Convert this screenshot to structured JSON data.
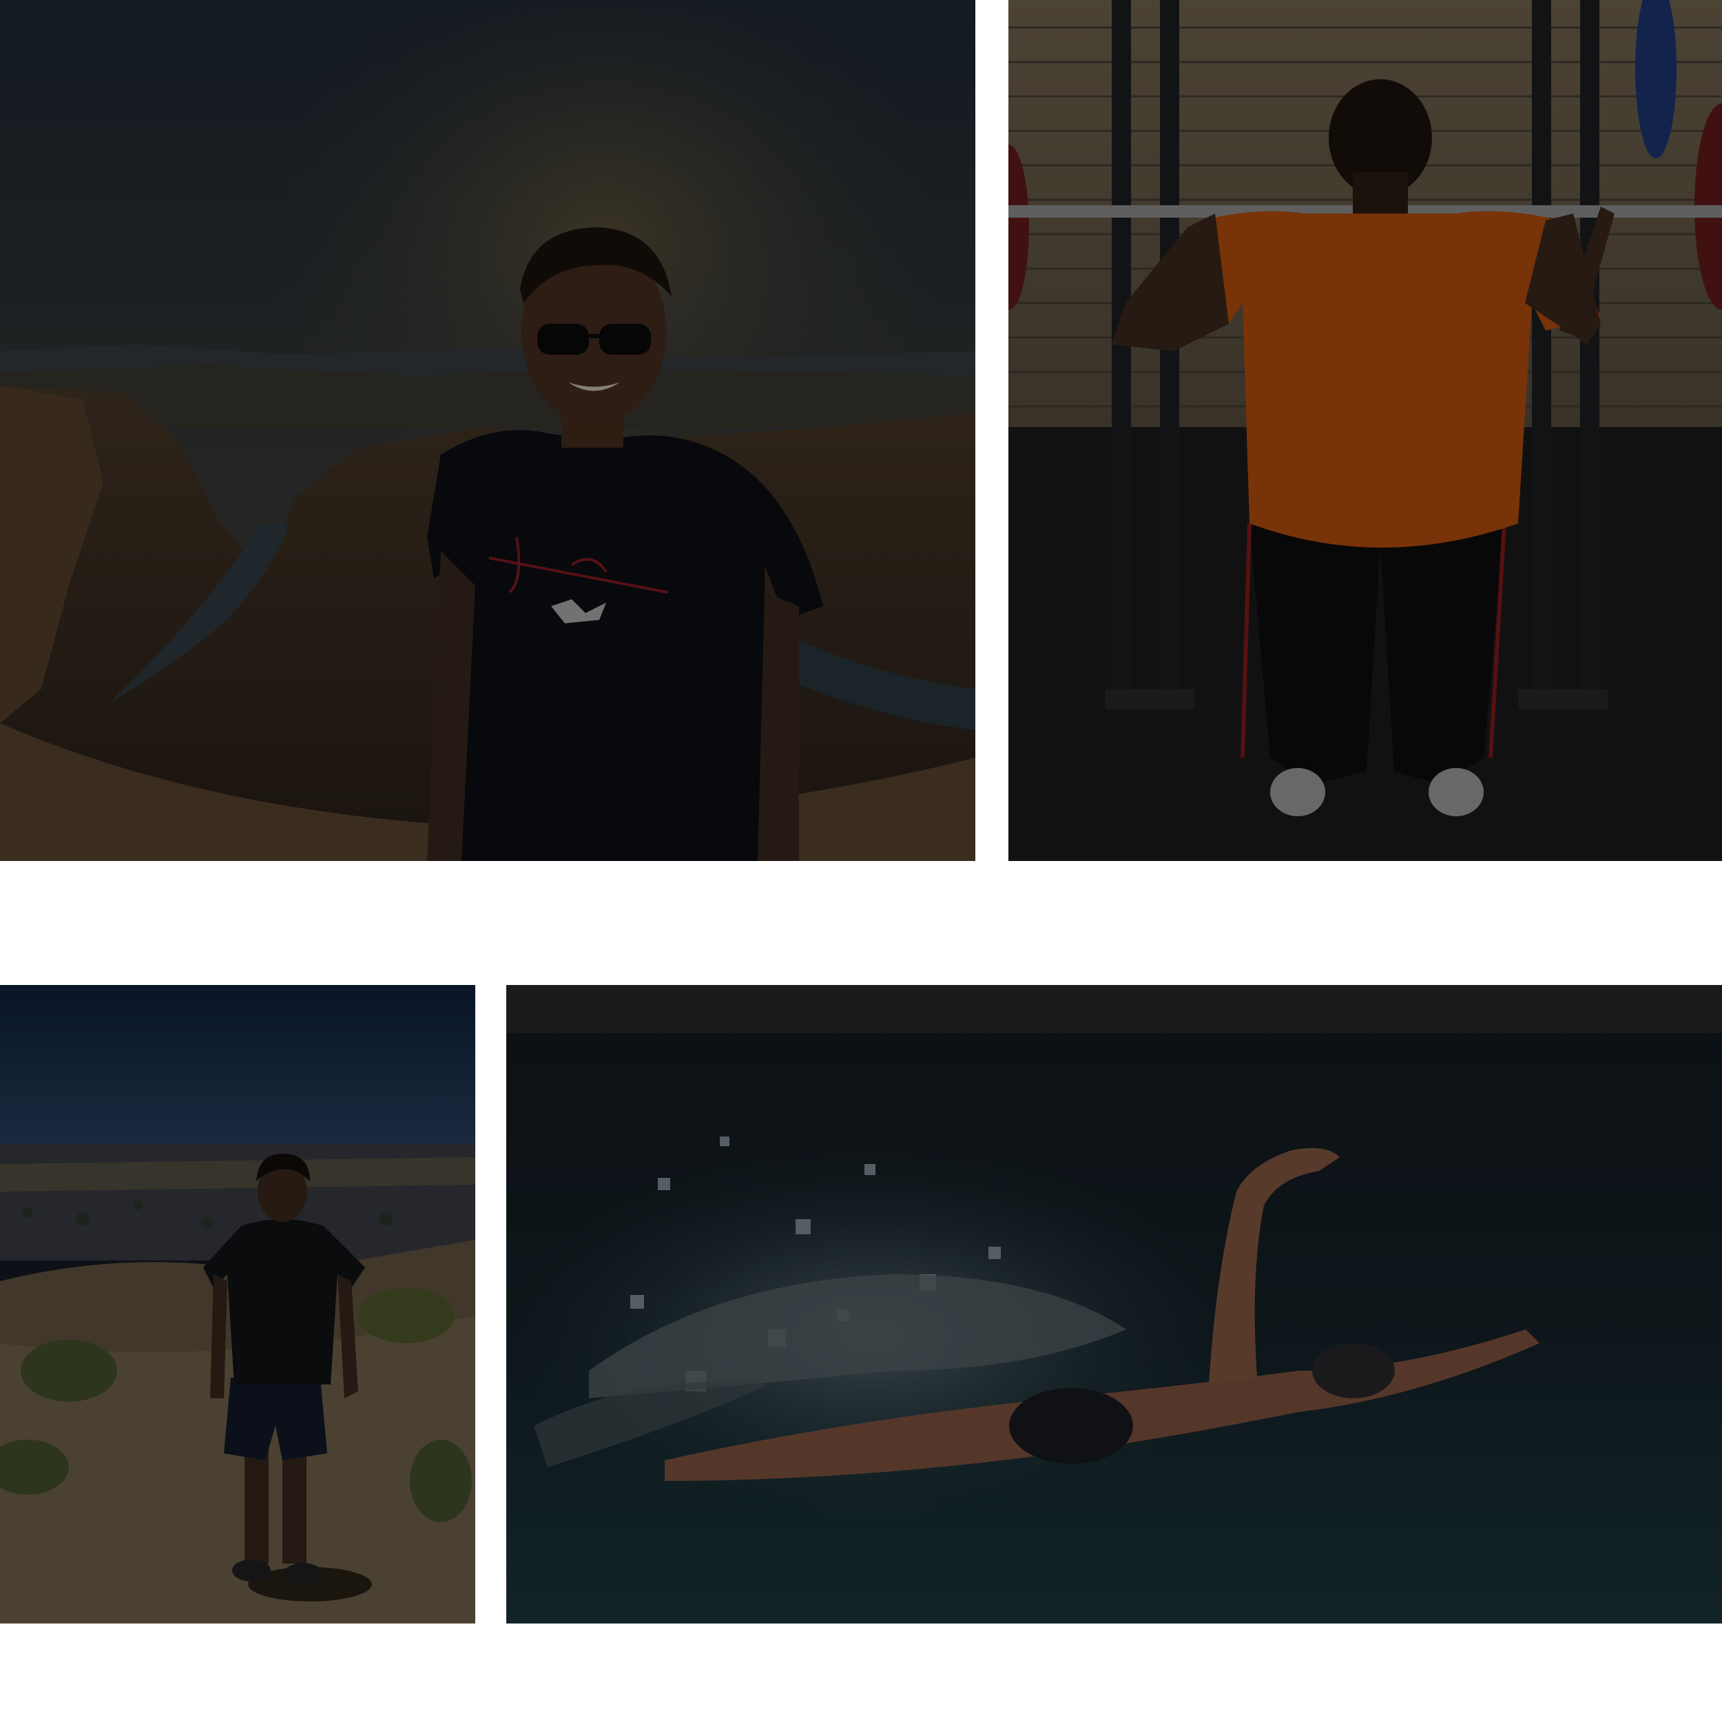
{
  "gallery": {
    "photos": [
      {
        "name": "photo-canyon"
      },
      {
        "name": "photo-gym"
      },
      {
        "name": "photo-hike"
      },
      {
        "name": "photo-swim"
      }
    ],
    "colors": {
      "background": "#ffffff",
      "shirt_orange": "#d4570f",
      "sky_navy": "#0e1a2e",
      "water_teal": "#17313a"
    }
  }
}
